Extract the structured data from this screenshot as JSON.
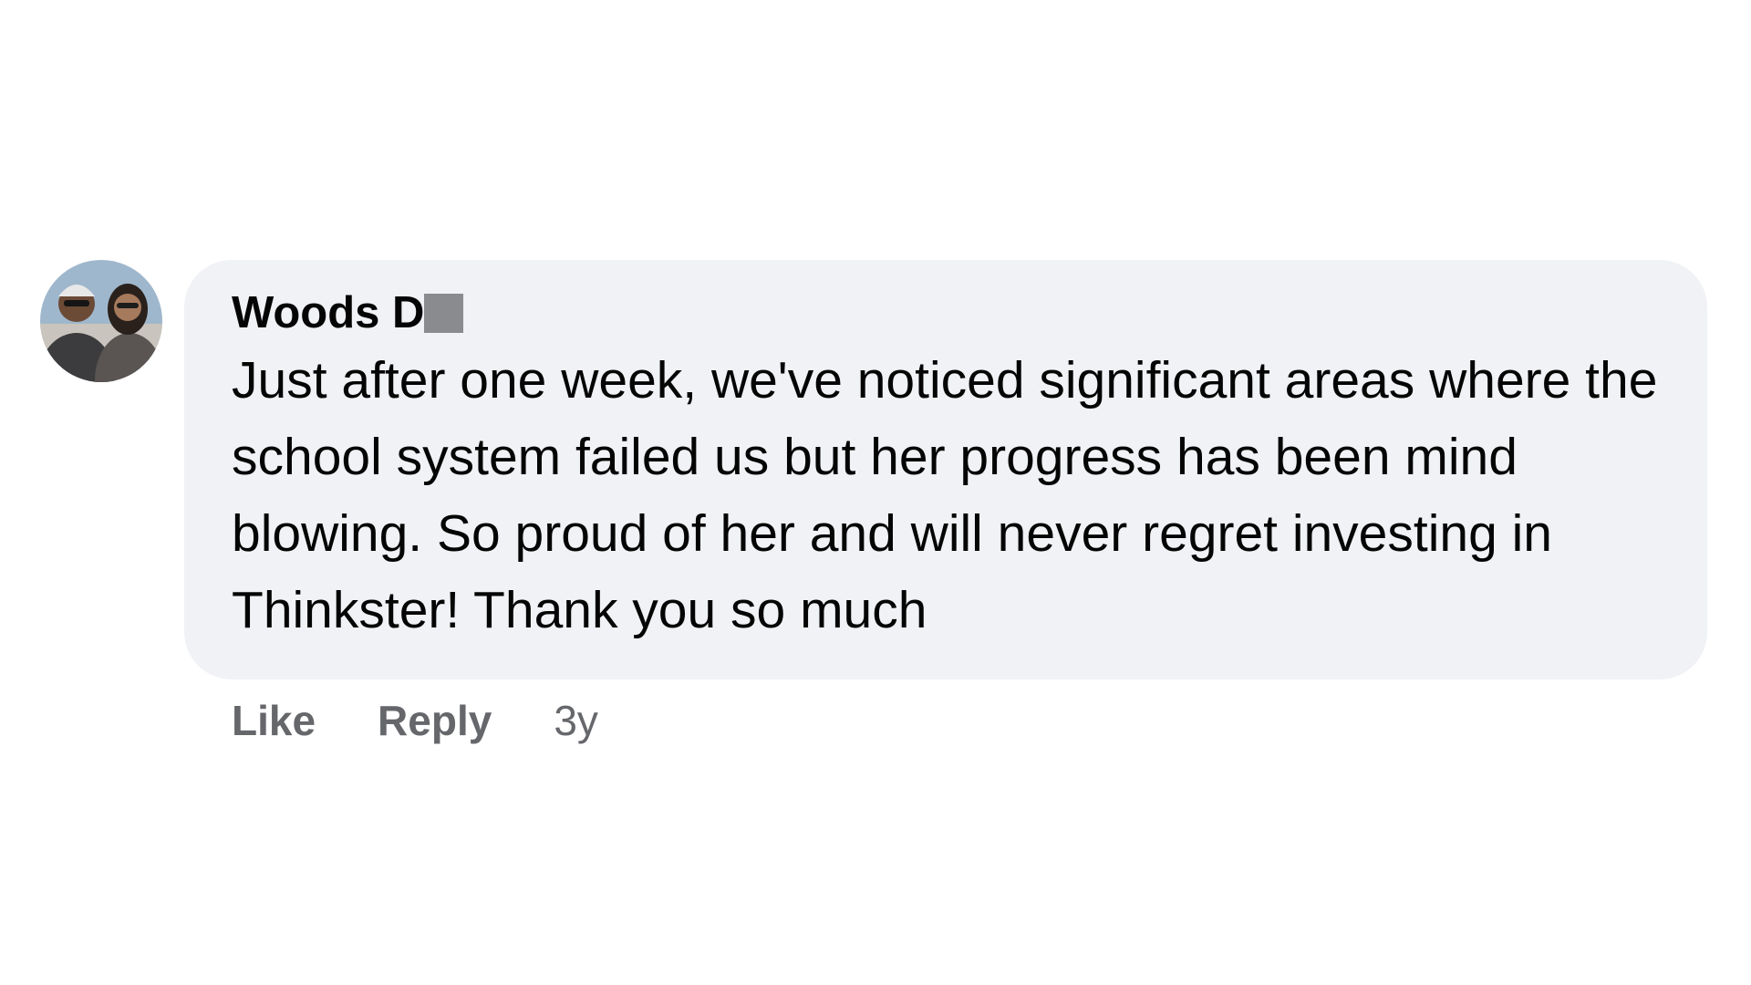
{
  "comment": {
    "author_name": "Woods D",
    "author_avatar_icon": "profile-photo",
    "text": "Just after one week, we've noticed significant areas where the school system failed us but her progress has been mind blowing. So proud of her and will never regret investing in Thinkster! Thank you so much",
    "actions": {
      "like_label": "Like",
      "reply_label": "Reply"
    },
    "timestamp": "3y"
  },
  "colors": {
    "bubble_background": "#f0f2f5",
    "text_primary": "#050505",
    "text_secondary": "#65676b",
    "redaction": "#8a8b8f"
  }
}
